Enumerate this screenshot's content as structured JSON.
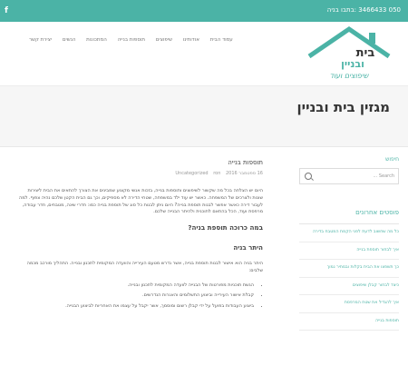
{
  "topbar": {
    "facebook_icon": "f",
    "phone": "050 3466433 :בתבו בניה"
  },
  "nav": {
    "items": [
      "עמוד הבית",
      "אודותינו",
      "שיפוצים",
      "תוספות בנייה",
      "המתכונות",
      "הנשים",
      "יצירת קשר"
    ]
  },
  "logo": {
    "main": "בית",
    "second": "ובניין",
    "tagline": "שיפוצים ועוד"
  },
  "page": {
    "title": "מגזין בית ובניין"
  },
  "sidebar": {
    "search_title": "חיפוש",
    "search_placeholder": "Search ...",
    "recent_title": "פוסטים אחרונים",
    "recent_posts": [
      "כל מה שחשוב לדעת לפני הקמת המטבח בדירה",
      "איך לבחור תוספת בנייה",
      "כך תשפצו את הבית בקלות ובמחיר נמוך",
      "כיצד לבחור קבלן שיפוצים",
      "איך להגדיל את שטח המרפסת",
      "תוספות בנייה"
    ]
  },
  "post": {
    "title": "תוספות בנייה",
    "meta_date": "16 ספטמבר 2016",
    "meta_author": "ron",
    "meta_category": "Uncategorized",
    "intro": "היום יש הצלחה בכל מה שקשור לשיפוצים ותוספות בנייה, בזכות אנשי מקצוע שמבינים את הצורך להתאים את הבית ליצירות שונות ולצרכים של המשפחה. כאשר יש עוד ילד במשפחה, שטחי הדירה לא מספיקים, וכך גם הבית הקטן שלכם נהיה צפוף. למה לעבור דירה כאשר אפשר לבנות תוספת בנייה? היום ניתן לבנות כל סוג של תוספת בנייה כמו: חדרי שינה, מטבחים, חדר עבודה, מרפסת ועוד, הכל בהתאם לתוכנית ולהיתר הבנייה שלכם.",
    "h2": "במה כרוכה תוספת בניה?",
    "h3": "היתר בניה",
    "para2": "היתר בניה הוא אישור לבנות תוספת בנייה, אשר נדרש מטעם העירייה והוועדה המקומית לתכנון ובנייה. התהליך מורכב מכמה שלבים:",
    "bullets": [
      "הגשת תוכניות מפורטות של הבנייה לוועדה המקומית לתכנון ובנייה.",
      "קבלת אישור העירייה וביצוע התשלומים והאגרות הנדרשים.",
      "ביצוע העבודות בפועל על ידי קבלן רשום ומוסמך, אשר יקבל על עצמו את האחריות לביצוע הבנייה."
    ]
  },
  "colors": {
    "accent": "#4bb3a6"
  }
}
